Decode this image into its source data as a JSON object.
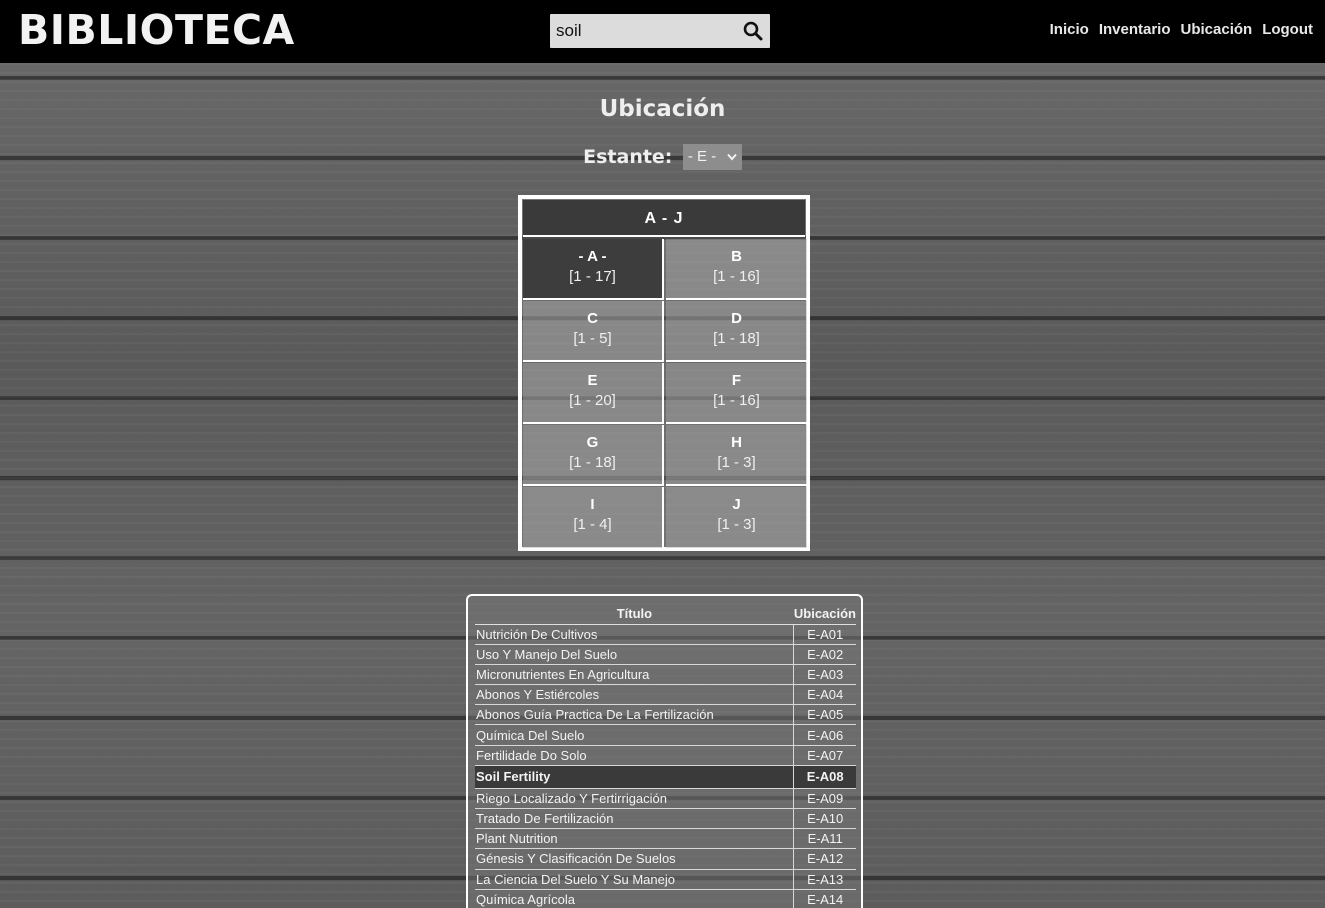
{
  "header": {
    "brand": "BIBLIOTECA",
    "search_value": "soil",
    "nav": [
      "Inicio",
      "Inventario",
      "Ubicación",
      "Logout"
    ]
  },
  "page": {
    "title": "Ubicación",
    "estante_label": "Estante:",
    "estante_value": "- E -"
  },
  "shelf": {
    "header": "A  -  J",
    "cells": [
      {
        "name": "- A -",
        "range": "[1 - 17]",
        "active": true
      },
      {
        "name": "B",
        "range": "[1 - 16]"
      },
      {
        "name": "C",
        "range": "[1 - 5]"
      },
      {
        "name": "D",
        "range": "[1 - 18]"
      },
      {
        "name": "E",
        "range": "[1 - 20]"
      },
      {
        "name": "F",
        "range": "[1 - 16]"
      },
      {
        "name": "G",
        "range": "[1 - 18]"
      },
      {
        "name": "H",
        "range": "[1 - 3]"
      },
      {
        "name": "I",
        "range": "[1 - 4]"
      },
      {
        "name": "J",
        "range": "[1 - 3]"
      }
    ]
  },
  "results": {
    "col_title": "Título",
    "col_location": "Ubicación",
    "rows": [
      {
        "title": "Nutrición De Cultivos",
        "loc": "E-A01"
      },
      {
        "title": "Uso Y Manejo Del Suelo",
        "loc": "E-A02"
      },
      {
        "title": "Micronutrientes En Agricultura",
        "loc": "E-A03"
      },
      {
        "title": "Abonos Y Estiércoles",
        "loc": "E-A04"
      },
      {
        "title": "Abonos Guía Practica De La Fertilización",
        "loc": "E-A05"
      },
      {
        "title": "Química Del Suelo",
        "loc": "E-A06"
      },
      {
        "title": "Fertilidade Do Solo",
        "loc": "E-A07"
      },
      {
        "title": "Soil Fertility",
        "loc": "E-A08",
        "highlight": true
      },
      {
        "title": "Riego Localizado Y Fertirrigación",
        "loc": "E-A09"
      },
      {
        "title": "Tratado De Fertilización",
        "loc": "E-A10"
      },
      {
        "title": "Plant Nutrition",
        "loc": "E-A11"
      },
      {
        "title": "Génesis Y Clasificación De Suelos",
        "loc": "E-A12"
      },
      {
        "title": "La Ciencia Del Suelo Y Su Manejo",
        "loc": "E-A13"
      },
      {
        "title": "Química Agrícola",
        "loc": "E-A14"
      }
    ]
  },
  "colors": {
    "topbar": "#000000",
    "active_cell": "#3d3d3d",
    "highlight_row": "#3a3a3a"
  },
  "icons": [
    "search-icon",
    "chevron-down-icon"
  ]
}
